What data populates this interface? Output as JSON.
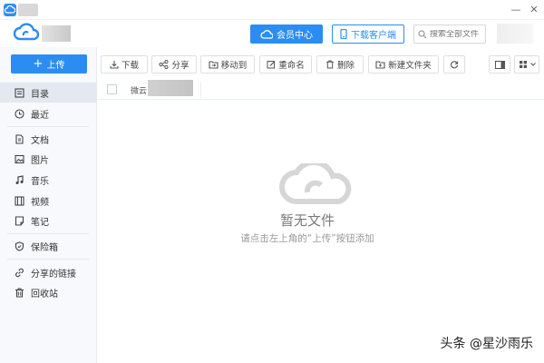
{
  "titlebar": {
    "min": "—",
    "close": "✕"
  },
  "header": {
    "member_center": "会员中心",
    "download_client": "下载客户端",
    "search_placeholder": "搜索全部文件"
  },
  "sidebar": {
    "upload_label": "上传",
    "items": [
      {
        "label": "目录",
        "icon": "directory-icon"
      },
      {
        "label": "最近",
        "icon": "clock-icon"
      },
      {
        "label": "文档",
        "icon": "document-icon"
      },
      {
        "label": "图片",
        "icon": "image-icon"
      },
      {
        "label": "音乐",
        "icon": "music-icon"
      },
      {
        "label": "视频",
        "icon": "video-icon"
      },
      {
        "label": "笔记",
        "icon": "note-icon"
      },
      {
        "label": "保险箱",
        "icon": "shield-icon"
      },
      {
        "label": "分享的链接",
        "icon": "link-icon"
      },
      {
        "label": "回收站",
        "icon": "trash-icon"
      }
    ]
  },
  "toolbar": {
    "download": "下载",
    "share": "分享",
    "move_to": "移动到",
    "rename": "重命名",
    "delete": "删除",
    "new_folder": "新建文件夹"
  },
  "breadcrumb": {
    "root": "微云"
  },
  "empty_state": {
    "title": "暂无文件",
    "hint": "请点击左上角的“上传”按钮添加"
  },
  "watermark": "头条 @星沙雨乐",
  "colors": {
    "accent": "#2b8df2",
    "sidebar_bg": "#f7f9fc",
    "active_bg": "#e4e9f1"
  }
}
